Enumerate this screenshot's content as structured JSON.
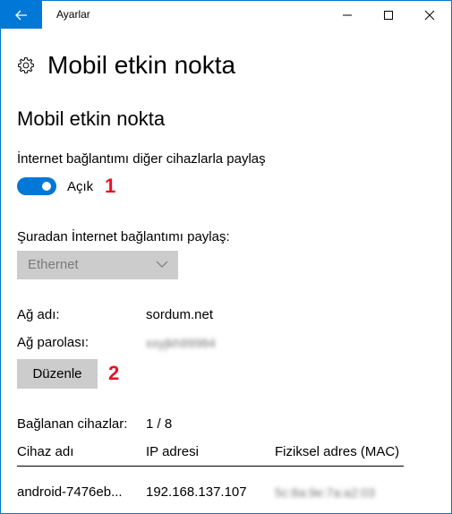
{
  "window": {
    "title": "Ayarlar"
  },
  "header": {
    "title": "Mobil etkin nokta",
    "icon": "gear-icon"
  },
  "section": {
    "title": "Mobil etkin nokta"
  },
  "share": {
    "label": "İnternet bağlantımı diğer cihazlarla paylaş",
    "toggle_state": "Açık",
    "toggle_on": true,
    "annotation": "1"
  },
  "source": {
    "label": "Şuradan İnternet bağlantımı paylaş:",
    "selected": "Ethernet"
  },
  "network": {
    "name_label": "Ağ adı:",
    "name_value": "sordum.net",
    "password_label": "Ağ parolası:",
    "password_value": "xxyjkh99984"
  },
  "edit": {
    "button_label": "Düzenle",
    "annotation": "2"
  },
  "devices": {
    "connected_label": "Bağlanan cihazlar:",
    "connected_value": "1 / 8",
    "columns": [
      "Cihaz adı",
      "IP adresi",
      "Fiziksel adres (MAC)"
    ],
    "rows": [
      {
        "name": "android-7476eb...",
        "ip": "192.168.137.107",
        "mac": "5c:8a:9e:7a:a2:03"
      }
    ]
  },
  "colors": {
    "accent": "#0078d7",
    "annotation": "#e81123",
    "disabled_bg": "#cccccc"
  }
}
